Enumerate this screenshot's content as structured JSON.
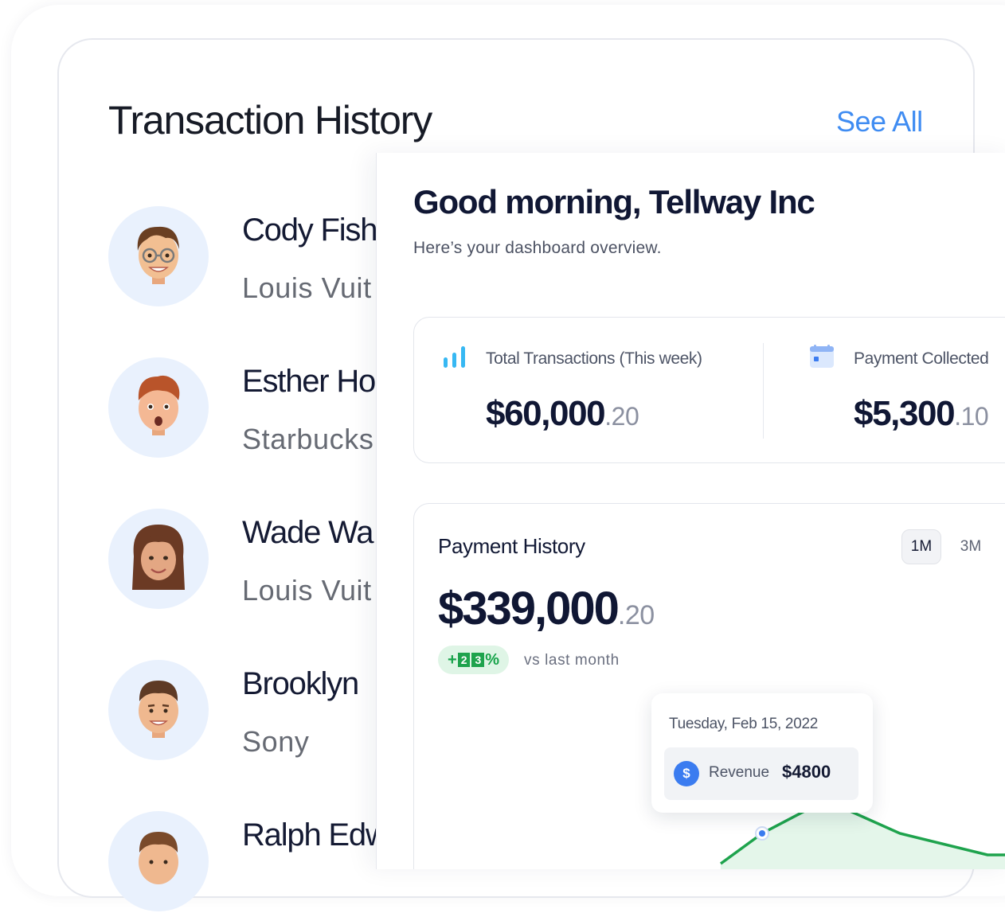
{
  "transaction_history": {
    "title": "Transaction History",
    "see_all_label": "See All",
    "rows": [
      {
        "name": "Cody Fish",
        "merchant": "Louis Vuit"
      },
      {
        "name": "Esther Ho",
        "merchant": "Starbucks"
      },
      {
        "name": "Wade Wa",
        "merchant": "Louis Vuit"
      },
      {
        "name": "Brooklyn",
        "merchant": "Sony"
      },
      {
        "name": "Ralph Edw",
        "merchant": ""
      }
    ]
  },
  "dashboard": {
    "greeting": "Good morning, Tellway Inc",
    "subtitle": "Here’s your dashboard overview.",
    "stats": {
      "total": {
        "icon": "bar-chart-icon",
        "label": "Total Transactions (This week)",
        "value": "$60,000",
        "cents": ".20"
      },
      "collected": {
        "icon": "calendar-icon",
        "label": "Payment Collected",
        "value": "$5,300",
        "cents": ".10"
      }
    },
    "payment_history": {
      "title": "Payment History",
      "ranges": [
        "1M",
        "3M"
      ],
      "active_range": "1M",
      "value": "$339,000",
      "cents": ".20",
      "growth": {
        "prefix": "+",
        "digits": [
          "2",
          "3"
        ],
        "suffix": "%"
      },
      "vs_label": "vs last month",
      "tooltip": {
        "date": "Tuesday, Feb 15, 2022",
        "icon": "dollar-icon",
        "icon_glyph": "$",
        "metric_label": "Revenue",
        "metric_value": "$4800"
      }
    }
  },
  "colors": {
    "accent_blue": "#3f8cf2",
    "chart_green": "#1ea34d",
    "avatar_bg": "#e9f1fd"
  }
}
